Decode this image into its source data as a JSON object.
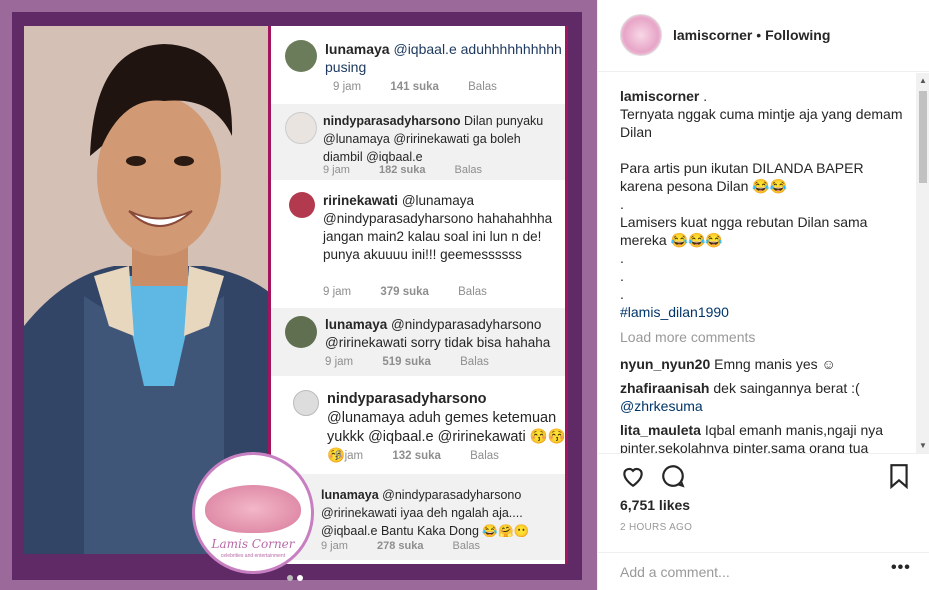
{
  "post_image": {
    "comments": [
      {
        "user": "lunamaya",
        "text": "@iqbaal.e aduhhhhhhhhhh pusing",
        "time": "9 jam",
        "likes": "141 suka",
        "reply": "Balas"
      },
      {
        "user": "nindyparasadyharsono",
        "text": "Dilan punyaku @lunamaya @ririnekawati ga boleh diambil @iqbaal.e",
        "time": "9 jam",
        "likes": "182 suka",
        "reply": "Balas"
      },
      {
        "user": "ririnekawati",
        "text": "@lunamaya @nindyparasadyharsono hahahahhha jangan main2 kalau soal ini lun n de! punya akuuuu ini!!! geemessssss",
        "time": "9 jam",
        "likes": "379 suka",
        "reply": "Balas"
      },
      {
        "user": "lunamaya",
        "text": "@nindyparasadyharsono @ririnekawati sorry tidak bisa hahaha",
        "time": "9 jam",
        "likes": "519 suka",
        "reply": "Balas"
      },
      {
        "user": "nindyparasadyharsono",
        "text": "@lunamaya aduh gemes ketemuan yukkk @iqbaal.e @ririnekawati 😚😚😚",
        "time": "9 jam",
        "likes": "132 suka",
        "reply": "Balas"
      },
      {
        "user": "lunamaya",
        "text": "@nindyparasadyharsono @ririnekawati iyaa deh ngalah aja.... @iqbaal.e Bantu Kaka Dong 😂🤗😶",
        "time": "9 jam",
        "likes": "278 suka",
        "reply": "Balas"
      }
    ],
    "logo_text": "Lamis Corner",
    "logo_sub": "celebrities and entertainment"
  },
  "header": {
    "username": "lamiscorner",
    "separator": "•",
    "follow_status": "Following"
  },
  "caption": {
    "username": "lamiscorner",
    "first": ".",
    "lines": [
      "Ternyata nggak cuma mintje aja yang demam Dilan",
      "",
      "Para artis pun ikutan DILANDA BAPER karena pesona Dilan 😂😂",
      ".",
      "Lamisers kuat ngga rebutan Dilan sama mereka 😂😂😂",
      ".",
      ".",
      "."
    ],
    "hashtag": "#lamis_dilan1990"
  },
  "load_more": "Load more comments",
  "comments": [
    {
      "user": "nyun_nyun20",
      "text": "Emng manis yes ☺"
    },
    {
      "user": "zhafiraanisah",
      "text": "dek saingannya berat :(",
      "mention": "@zhrkesuma"
    },
    {
      "user": "lita_mauleta",
      "text": "Iqbal emanh manis,ngaji nya pinter,sekolahnya pinter,sama orang tua"
    }
  ],
  "likes": "6,751 likes",
  "timestamp": "2 HOURS AGO",
  "add_comment_placeholder": "Add a comment...",
  "more_label": "•••"
}
